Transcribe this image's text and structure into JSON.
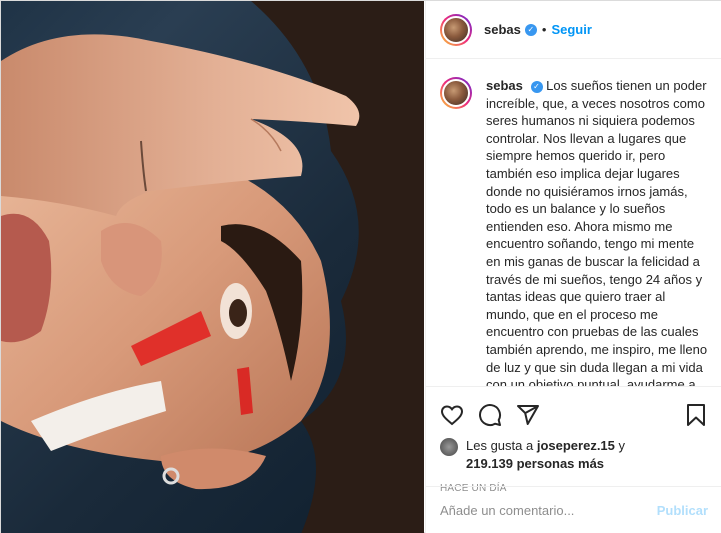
{
  "post": {
    "username": "sebas",
    "verified_mark": "✓",
    "dot": "•",
    "follow_label": "Seguir",
    "caption": "Los sueños tienen un poder increíble, que, a veces nosotros como seres humanos ni siquiera podemos controlar. Nos llevan a lugares que siempre hemos querido ir, pero también eso implica dejar lugares donde no quisiéramos irnos jamás, todo es un balance y lo sueños entienden eso. Ahora mismo me encuentro soñando, tengo mi mente en mis ganas de buscar la felicidad a través de mi sueños, tengo 24 años y tantas ideas que quiero traer al mundo, que en el proceso me encuentro con pruebas de las cuales también aprendo, me inspiro, me lleno de luz y que sin duda llegan a mi vida con un objetivo puntual, ayudarme a soñar. Agradezco",
    "likes_prefix": "Les gusta a",
    "likes_user": "joseperez.15",
    "likes_and": "y",
    "likes_count": "219.139 personas más",
    "timestamp": "HACE UN DÍA",
    "comment_placeholder": "Añade un comentario...",
    "publish_label": "Publicar"
  },
  "icons": [
    "heart-icon",
    "comment-icon",
    "share-icon",
    "bookmark-icon"
  ],
  "colors": {
    "link": "#0095f6",
    "verified": "#3897f0",
    "publish_disabled": "#b2dffc"
  }
}
